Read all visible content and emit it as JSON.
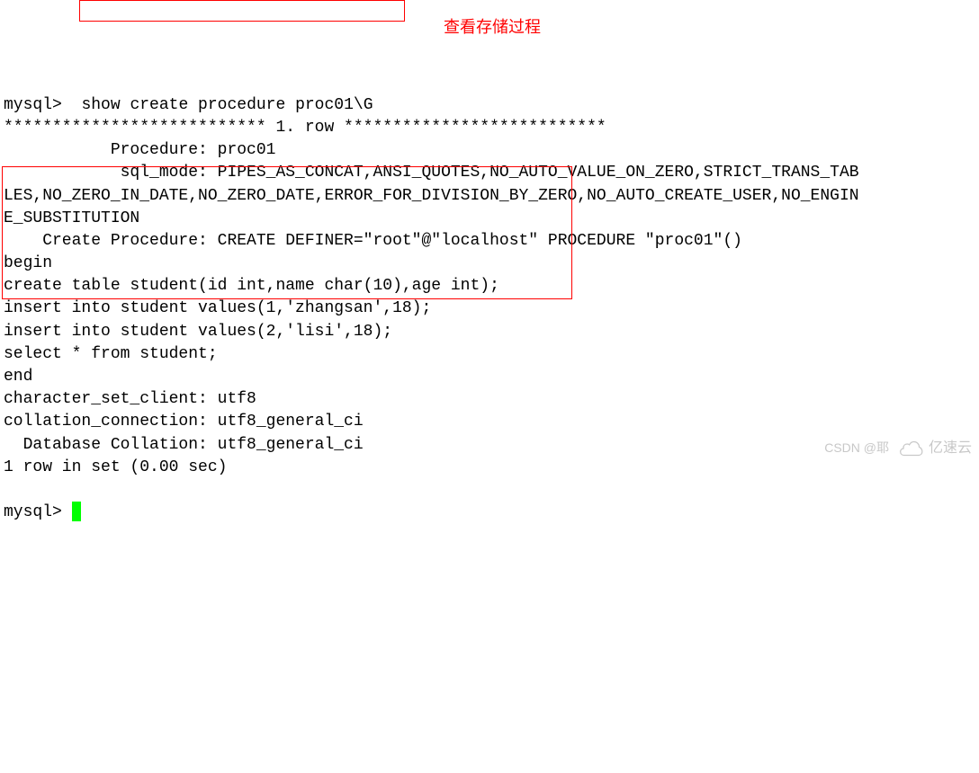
{
  "prompt1": "mysql> ",
  "command": "show create procedure proc01\\G",
  "annotation": "查看存储过程",
  "row_separator": "*************************** 1. row ***************************",
  "proc_field": "           Procedure: proc01",
  "sql_mode_line1": "            sql_mode: PIPES_AS_CONCAT,ANSI_QUOTES,NO_AUTO_VALUE_ON_ZERO,STRICT_TRANS_TAB",
  "sql_mode_line2": "LES,NO_ZERO_IN_DATE,NO_ZERO_DATE,ERROR_FOR_DIVISION_BY_ZERO,NO_AUTO_CREATE_USER,NO_ENGIN",
  "sql_mode_line3": "E_SUBSTITUTION",
  "create_proc": "    Create Procedure: CREATE DEFINER=\"root\"@\"localhost\" PROCEDURE \"proc01\"()",
  "body1": "begin",
  "body2": "create table student(id int,name char(10),age int);",
  "body3": "insert into student values(1,'zhangsan',18);",
  "body4": "insert into student values(2,'lisi',18);",
  "body5": "select * from student;",
  "body6": "end",
  "cs_client": "character_set_client: utf8",
  "coll_conn": "collation_connection: utf8_general_ci",
  "db_coll": "  Database Collation: utf8_general_ci",
  "rows_result": "1 row in set (0.00 sec)",
  "prompt2": "mysql> ",
  "watermark_csdn": "CSDN @耶",
  "watermark_brand": "亿速云"
}
